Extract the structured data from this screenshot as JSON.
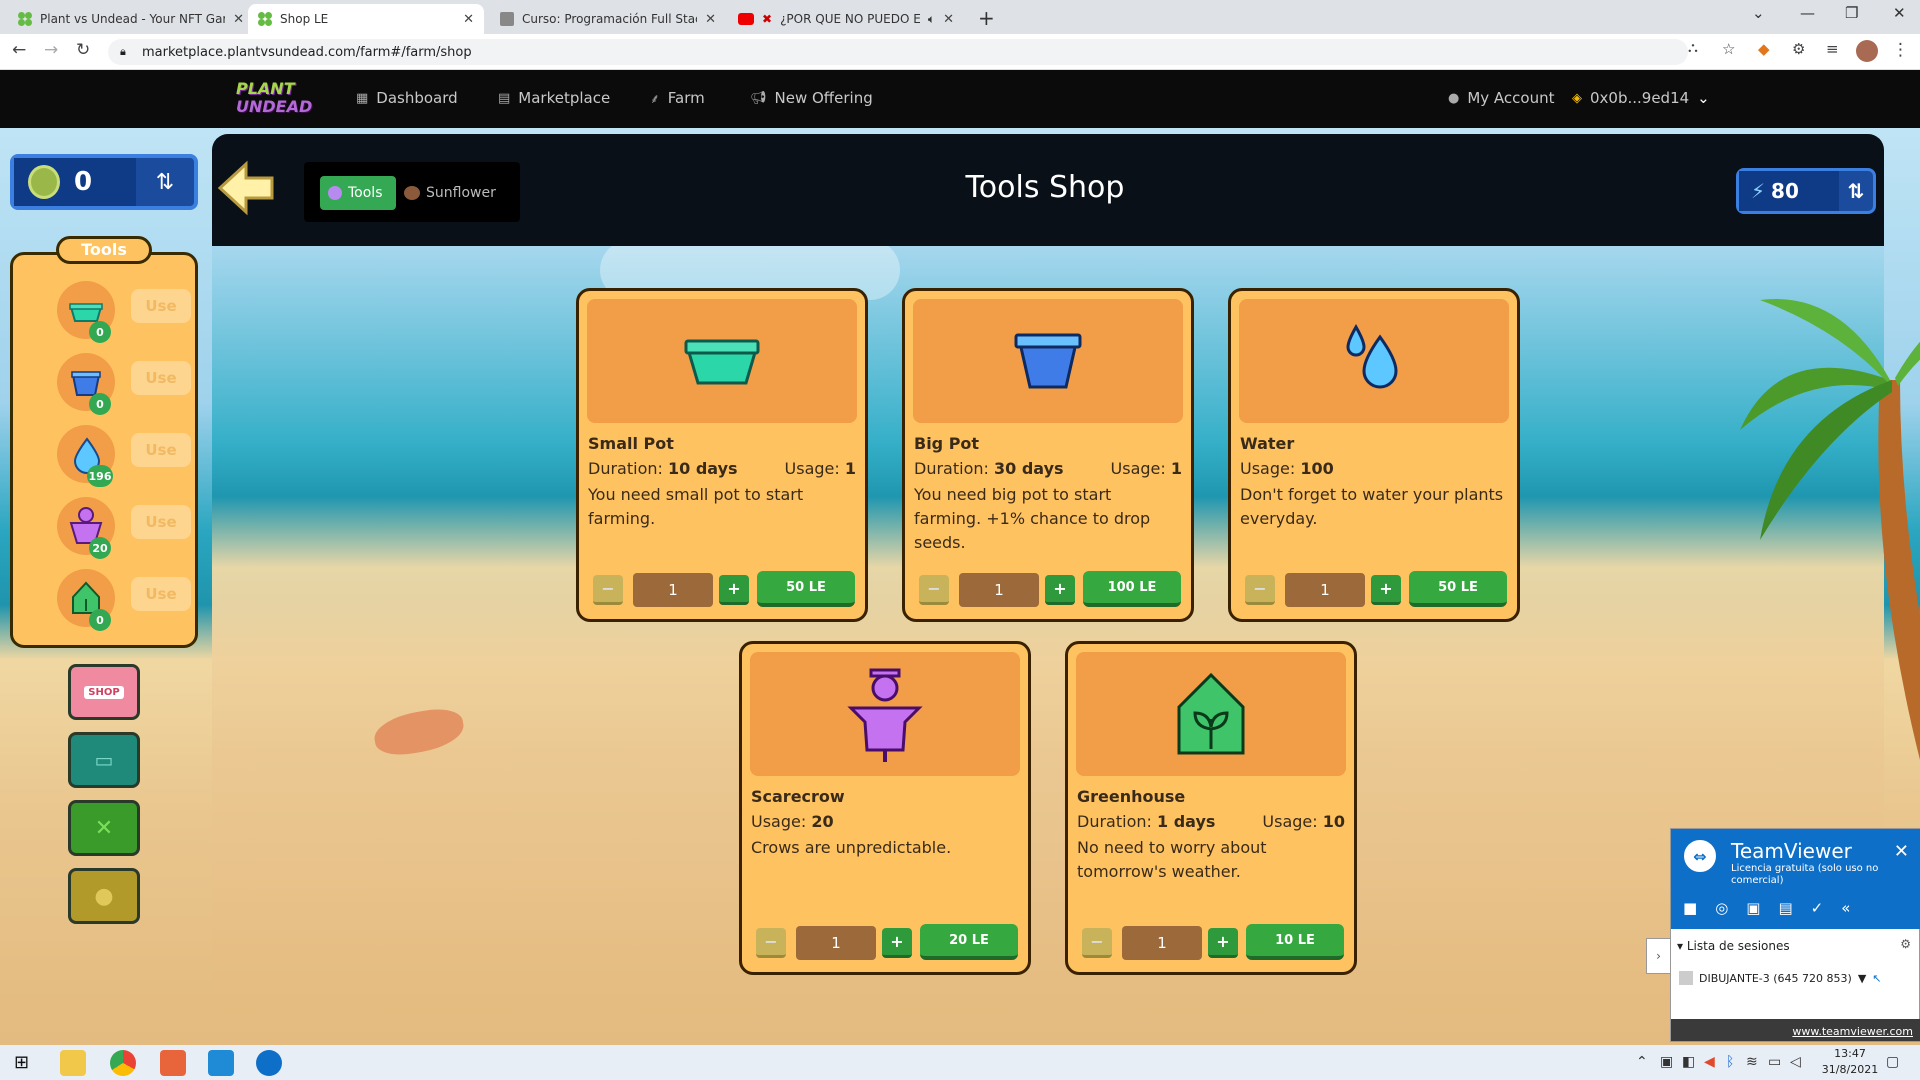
{
  "browser": {
    "tabs": [
      {
        "title": "Plant vs Undead - Your NFT Gard",
        "active": false
      },
      {
        "title": "Shop LE",
        "active": true
      },
      {
        "title": "Curso: Programación Full Stack",
        "active": false
      },
      {
        "title": "¿POR QUE NO PUEDO EN",
        "active": false
      }
    ],
    "url": "marketplace.plantvsundead.com/farm#/farm/shop"
  },
  "gamenav": {
    "logo_line1": "PLANT",
    "logo_line2": "UNDEAD",
    "dashboard": "Dashboard",
    "marketplace": "Marketplace",
    "farm": "Farm",
    "new_offering": "New Offering",
    "my_account": "My Account",
    "wallet": "0x0b...9ed14"
  },
  "balance": {
    "le": "0"
  },
  "energy": "80",
  "shop": {
    "title": "Tools Shop",
    "tab_tools": "Tools",
    "tab_sunflower": "Sunflower"
  },
  "inventory": {
    "label": "Tools",
    "use_label": "Use",
    "counts": [
      "0",
      "0",
      "196",
      "20",
      "0"
    ]
  },
  "sidebar": {
    "shop_label": "SHOP"
  },
  "cards": [
    {
      "name": "Small Pot",
      "duration_label": "Duration:",
      "duration": "10 days",
      "usage_label": "Usage:",
      "usage": "1",
      "desc": "You need small pot to start farming.",
      "qty": "1",
      "price": "50 LE"
    },
    {
      "name": "Big Pot",
      "duration_label": "Duration:",
      "duration": "30 days",
      "usage_label": "Usage:",
      "usage": "1",
      "desc": "You need big pot to start farming. +1% chance to drop seeds.",
      "qty": "1",
      "price": "100 LE"
    },
    {
      "name": "Water",
      "usage_label": "Usage:",
      "usage": "100",
      "desc": "Don't forget to water your plants everyday.",
      "qty": "1",
      "price": "50 LE"
    },
    {
      "name": "Scarecrow",
      "usage_label": "Usage:",
      "usage": "20",
      "desc": "Crows are unpredictable.",
      "qty": "1",
      "price": "20 LE"
    },
    {
      "name": "Greenhouse",
      "duration_label": "Duration:",
      "duration": "1 days",
      "usage_label": "Usage:",
      "usage": "10",
      "desc": "No need to worry about tomorrow's weather.",
      "qty": "1",
      "price": "10 LE"
    }
  ],
  "buttons": {
    "minus": "−",
    "plus": "+"
  },
  "teamviewer": {
    "name": "TeamViewer",
    "license": "Licencia gratuita (solo uso no comercial)",
    "sessions_label": "Lista de sesiones",
    "session": "DIBUJANTE-3 (645 720 853)",
    "link": "www.teamviewer.com"
  },
  "clock": {
    "time": "13:47",
    "date": "31/8/2021"
  },
  "colors": {
    "accent_green": "#35a83f",
    "card_bg": "#fec360",
    "card_image_bg": "#f29d48",
    "le_panel": "#1b4b9c"
  }
}
